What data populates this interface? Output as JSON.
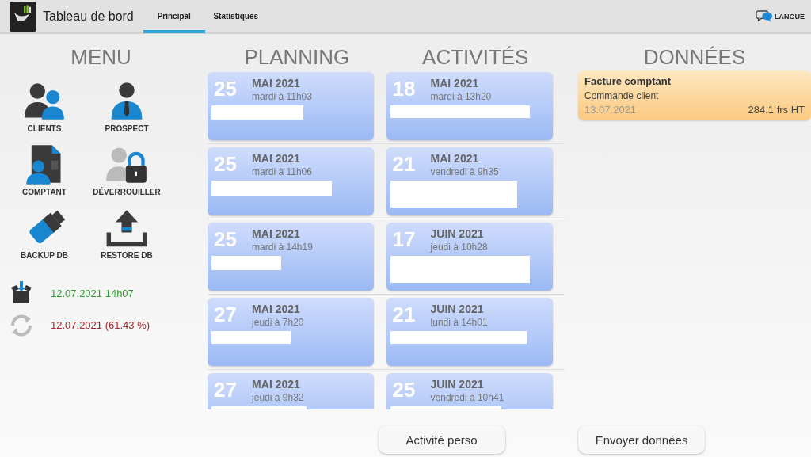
{
  "app_bar": {
    "title": "Tableau de bord",
    "tabs": [
      {
        "label": "Principal",
        "selected": true
      },
      {
        "label": "Statistiques",
        "selected": false
      }
    ],
    "language_button": "LANGUE"
  },
  "menu": {
    "heading": "MENU",
    "items": [
      {
        "kind": "clients",
        "label": "CLIENTS"
      },
      {
        "kind": "prospect",
        "label": "PROSPECT"
      },
      {
        "kind": "cash",
        "label": "COMPTANT"
      },
      {
        "kind": "unlock",
        "label": "DÉVERROUILLER"
      },
      {
        "kind": "backup",
        "label": "BACKUP DB"
      },
      {
        "kind": "restore",
        "label": "RESTORE DB"
      }
    ],
    "status": [
      {
        "kind": "received",
        "text": "12.07.2021 14h07",
        "color": "#2e9e2e"
      },
      {
        "kind": "sync",
        "text": "12.07.2021 (61.43 %)",
        "color": "#a82424"
      }
    ]
  },
  "planning": {
    "heading": "PLANNING",
    "cards": [
      {
        "day": "25",
        "month": "MAI 2021",
        "time": "mardi à 11h03"
      },
      {
        "day": "25",
        "month": "MAI 2021",
        "time": "mardi à 11h06"
      },
      {
        "day": "25",
        "month": "MAI 2021",
        "time": "mardi à 14h19"
      },
      {
        "day": "27",
        "month": "MAI 2021",
        "time": "jeudi à 7h20"
      },
      {
        "day": "27",
        "month": "MAI 2021",
        "time": "jeudi à 9h32"
      }
    ]
  },
  "activities": {
    "heading": "ACTIVITÉS",
    "cards": [
      {
        "day": "18",
        "month": "MAI 2021",
        "time": "mardi à 13h20"
      },
      {
        "day": "21",
        "month": "MAI 2021",
        "time": "vendredi à 9h35"
      },
      {
        "day": "17",
        "month": "JUIN 2021",
        "time": "jeudi à 10h28"
      },
      {
        "day": "21",
        "month": "JUIN 2021",
        "time": "lundi à 14h01"
      },
      {
        "day": "25",
        "month": "JUIN 2021",
        "time": "vendredi à 10h41"
      }
    ]
  },
  "data": {
    "heading": "DONNÉES",
    "cards": [
      {
        "title": "Facture comptant",
        "subtitle": "Commande client",
        "date": "13.07.2021",
        "amount": "284.1 frs HT"
      }
    ]
  },
  "buttons": [
    "Activité perso",
    "Envoyer données"
  ]
}
